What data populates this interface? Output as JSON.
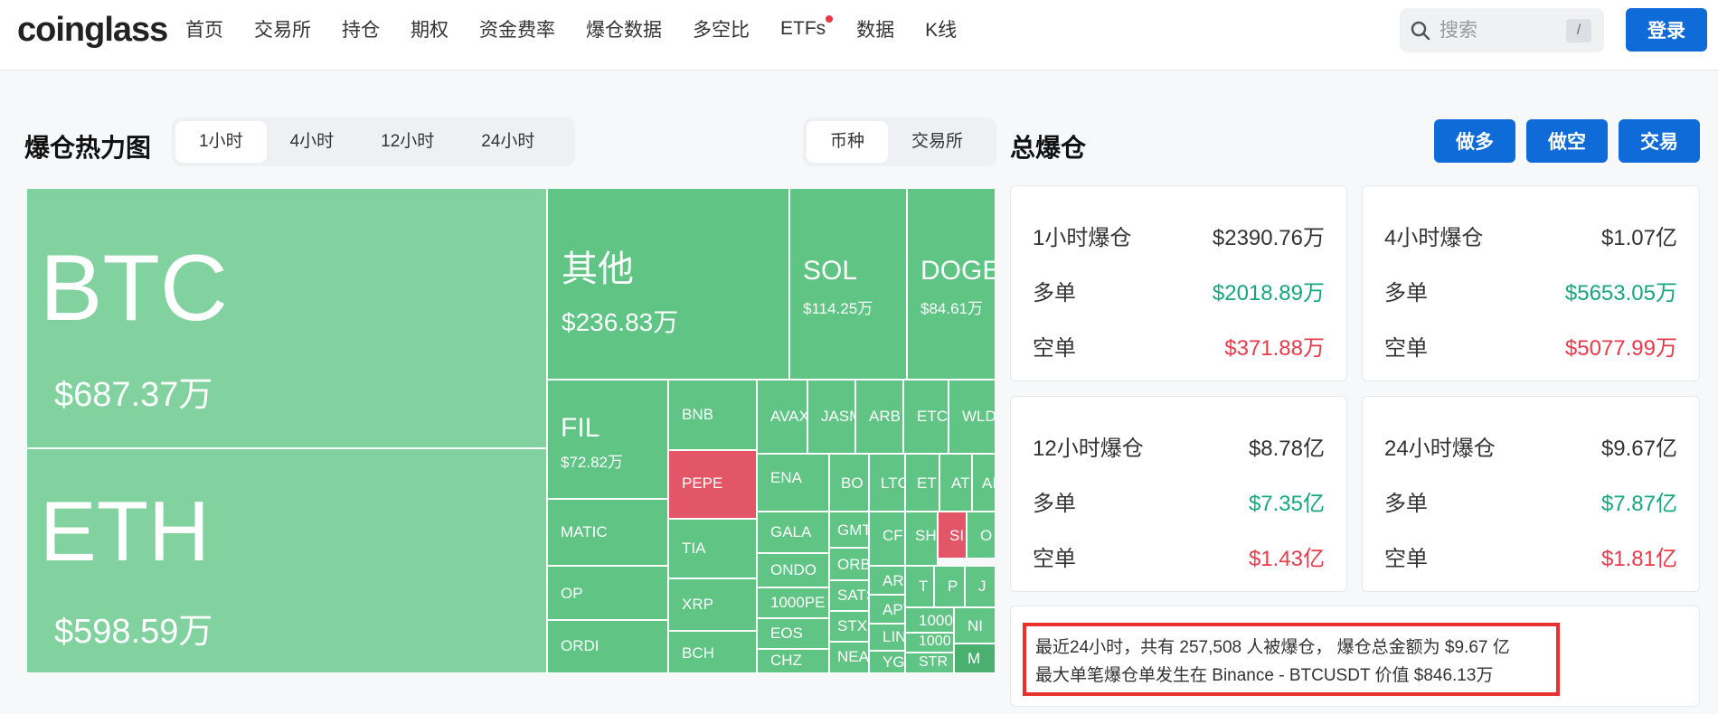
{
  "header": {
    "logo": "coinglass",
    "nav": [
      "首页",
      "交易所",
      "持仓",
      "期权",
      "资金费率",
      "爆仓数据",
      "多空比",
      "ETFs",
      "数据",
      "K线"
    ],
    "search_placeholder": "搜索",
    "search_shortcut": "/",
    "login": "登录"
  },
  "heatmap": {
    "title": "爆仓热力图",
    "time_tabs": [
      "1小时",
      "4小时",
      "12小时",
      "24小时"
    ],
    "active_time": "1小时",
    "group_tabs": [
      "币种",
      "交易所"
    ],
    "active_group": "币种",
    "tiles": [
      {
        "sym": "BTC",
        "val": "$687.37万",
        "color": "#81d29f"
      },
      {
        "sym": "ETH",
        "val": "$598.59万",
        "color": "#81d29f"
      },
      {
        "sym": "其他",
        "val": "$236.83万",
        "color": "#5fc484"
      },
      {
        "sym": "SOL",
        "val": "$114.25万",
        "color": "#5fc484"
      },
      {
        "sym": "DOGE",
        "val": "$84.61万",
        "color": "#5fc484"
      },
      {
        "sym": "FIL",
        "val": "$72.82万",
        "color": "#5fc484"
      },
      {
        "sym": "BNB"
      },
      {
        "sym": "AVAX"
      },
      {
        "sym": "JASMY"
      },
      {
        "sym": "ARB"
      },
      {
        "sym": "ETC"
      },
      {
        "sym": "WLD"
      },
      {
        "sym": "PEPE",
        "color": "#e25667"
      },
      {
        "sym": "ENA"
      },
      {
        "sym": "BO"
      },
      {
        "sym": "LTC"
      },
      {
        "sym": "ET"
      },
      {
        "sym": "AT"
      },
      {
        "sym": "AI"
      },
      {
        "sym": "MATIC"
      },
      {
        "sym": "TIA"
      },
      {
        "sym": "GALA"
      },
      {
        "sym": "GMT"
      },
      {
        "sym": "CF"
      },
      {
        "sym": "SH"
      },
      {
        "sym": "SI",
        "color": "#e25667"
      },
      {
        "sym": "O"
      },
      {
        "sym": "ONDO"
      },
      {
        "sym": "ORB"
      },
      {
        "sym": "OP"
      },
      {
        "sym": "XRP"
      },
      {
        "sym": "1000PE"
      },
      {
        "sym": "SATS"
      },
      {
        "sym": "AR"
      },
      {
        "sym": "T"
      },
      {
        "sym": "P"
      },
      {
        "sym": "J"
      },
      {
        "sym": "EOS"
      },
      {
        "sym": "STX"
      },
      {
        "sym": "APT"
      },
      {
        "sym": "1000"
      },
      {
        "sym": "NI"
      },
      {
        "sym": "ORDI"
      },
      {
        "sym": "BCH"
      },
      {
        "sym": "CHZ"
      },
      {
        "sym": "NEA"
      },
      {
        "sym": "LIN"
      },
      {
        "sym": "YGG"
      },
      {
        "sym": "1000"
      },
      {
        "sym": "STR"
      },
      {
        "sym": "M",
        "color": "#49b06f"
      }
    ]
  },
  "summary": {
    "title": "总爆仓",
    "buttons": [
      "做多",
      "做空",
      "交易"
    ],
    "long_label": "多单",
    "short_label": "空单",
    "cards": [
      {
        "label": "1小时爆仓",
        "total": "$2390.76万",
        "long": "$2018.89万",
        "short": "$371.88万"
      },
      {
        "label": "4小时爆仓",
        "total": "$1.07亿",
        "long": "$5653.05万",
        "short": "$5077.99万"
      },
      {
        "label": "12小时爆仓",
        "total": "$8.78亿",
        "long": "$7.35亿",
        "short": "$1.43亿"
      },
      {
        "label": "24小时爆仓",
        "total": "$9.67亿",
        "long": "$7.87亿",
        "short": "$1.81亿"
      }
    ],
    "info_line1": "最近24小时，共有 257,508 人被爆仓， 爆仓总金额为 $9.67 亿",
    "info_line2": "最大单笔爆仓单发生在 Binance - BTCUSDT 价值 $846.13万"
  }
}
